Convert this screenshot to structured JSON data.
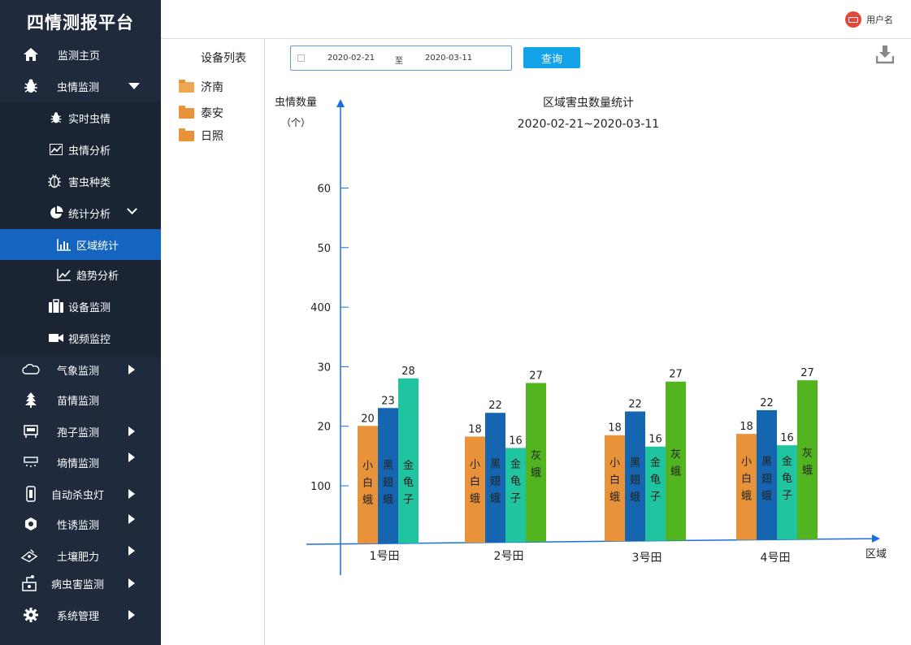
{
  "app": {
    "title": "四情测报平台"
  },
  "header": {
    "user_name": "用户名"
  },
  "sidebar": {
    "items": [
      {
        "label": "监测主页"
      },
      {
        "label": "虫情监测"
      },
      {
        "label": "实时虫情"
      },
      {
        "label": "虫情分析"
      },
      {
        "label": "害虫种类"
      },
      {
        "label": "统计分析"
      },
      {
        "label": "区域统计"
      },
      {
        "label": "趋势分析"
      },
      {
        "label": "设备监测"
      },
      {
        "label": "视频监控"
      },
      {
        "label": "气象监测"
      },
      {
        "label": "苗情监测"
      },
      {
        "label": "孢子监测"
      },
      {
        "label": "墒情监测"
      },
      {
        "label": "自动杀虫灯"
      },
      {
        "label": "性诱监测"
      },
      {
        "label": "土壤肥力"
      },
      {
        "label": "病虫害监测"
      },
      {
        "label": "系统管理"
      }
    ]
  },
  "devices": {
    "title": "设备列表",
    "items": [
      "济南",
      "泰安",
      "日照"
    ]
  },
  "filter": {
    "start_date": "2020-02-21",
    "separator": "至",
    "end_date": "2020-03-11",
    "query_label": "查询"
  },
  "colors": {
    "sidebar_bg": "#1f2a3c",
    "active": "#1565c0",
    "axis": "#1a6fe0",
    "series": [
      "#e8923a",
      "#1565b0",
      "#20c4a0",
      "#52b520"
    ]
  },
  "chart_data": {
    "type": "bar",
    "title": "区域害虫数量统计",
    "subtitle": "2020-02-21~2020-03-11",
    "ylabel": "虫情数量",
    "yunit": "（个）",
    "xlabel": "区域",
    "y_tick_labels": [
      "100",
      "20",
      "30",
      "400",
      "50",
      "60"
    ],
    "categories": [
      "1号田",
      "2号田",
      "3号田",
      "4号田"
    ],
    "groups": [
      {
        "category": "1号田",
        "bars": [
          {
            "name": "小白蛾",
            "value": 20
          },
          {
            "name": "黑翅蛾",
            "value": 23
          },
          {
            "name": "金龟子",
            "value": 28
          }
        ]
      },
      {
        "category": "2号田",
        "bars": [
          {
            "name": "小白蛾",
            "value": 18
          },
          {
            "name": "黑翅蛾",
            "value": 22
          },
          {
            "name": "金龟子",
            "value": 16
          },
          {
            "name": "灰蛾",
            "value": 27
          }
        ]
      },
      {
        "category": "3号田",
        "bars": [
          {
            "name": "小白蛾",
            "value": 18
          },
          {
            "name": "黑翅蛾",
            "value": 22
          },
          {
            "name": "金龟子",
            "value": 16
          },
          {
            "name": "灰蛾",
            "value": 27
          }
        ]
      },
      {
        "category": "4号田",
        "bars": [
          {
            "name": "小白蛾",
            "value": 18
          },
          {
            "name": "黑翅蛾",
            "value": 22
          },
          {
            "name": "金龟子",
            "value": 16
          },
          {
            "name": "灰蛾",
            "value": 27
          }
        ]
      }
    ]
  }
}
